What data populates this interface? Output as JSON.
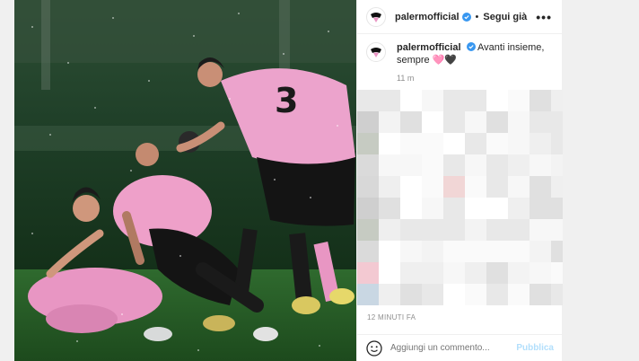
{
  "account": {
    "username": "palermofficial",
    "verified": true,
    "follow_label": "Segui già",
    "separator": "•",
    "more_label": "•••"
  },
  "caption": {
    "text": "Avanti insieme, sempre 🩷🖤",
    "time": "11 m"
  },
  "post": {
    "timestamp": "12 MINUTI FA"
  },
  "comment": {
    "placeholder": "Aggiungi un commento...",
    "publish_label": "Pubblica"
  },
  "photo": {
    "jersey_number": "3"
  },
  "colors": {
    "verified_blue": "#3897f0",
    "publish_disabled": "#b2dffc",
    "kit_pink": "#e996c4",
    "kit_black": "#141414"
  },
  "icons": {
    "avatar": "palermo-eagle-crest",
    "verified": "verified-badge-icon",
    "more": "more-options-icon",
    "emoji": "emoji-icon"
  }
}
